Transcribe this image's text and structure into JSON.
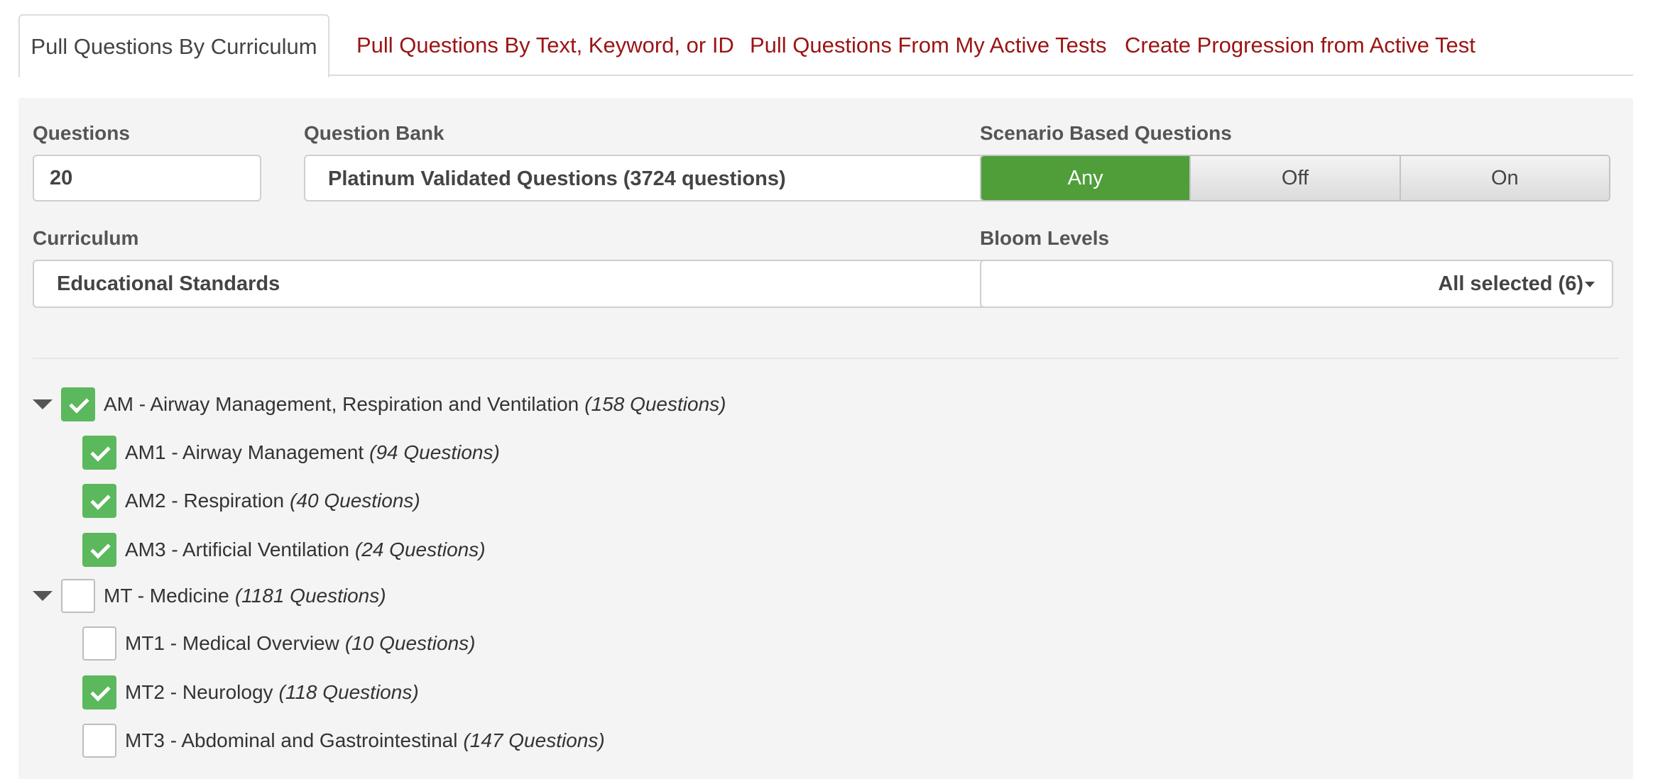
{
  "tabs": [
    {
      "label": "Pull Questions By Curriculum",
      "active": true
    },
    {
      "label": "Pull Questions By Text, Keyword, or ID",
      "active": false
    },
    {
      "label": "Pull Questions From My Active Tests",
      "active": false
    },
    {
      "label": "Create Progression from Active Test",
      "active": false
    }
  ],
  "form": {
    "questions_label": "Questions",
    "questions_value": "20",
    "bank_label": "Question Bank",
    "bank_value": "Platinum Validated Questions (3724 questions)",
    "scenario_label": "Scenario Based Questions",
    "scenario_options": [
      "Any",
      "Off",
      "On"
    ],
    "scenario_selected": "Any",
    "curriculum_label": "Curriculum",
    "curriculum_value": "Educational Standards",
    "bloom_label": "Bloom Levels",
    "bloom_value": "All selected (6)"
  },
  "tree": [
    {
      "code_name": "AM - Airway Management, Respiration and Ventilation",
      "count": "(158 Questions)",
      "checked": true,
      "level": 0
    },
    {
      "code_name": "AM1 - Airway Management",
      "count": "(94 Questions)",
      "checked": true,
      "level": 1
    },
    {
      "code_name": "AM2 - Respiration",
      "count": "(40 Questions)",
      "checked": true,
      "level": 1
    },
    {
      "code_name": "AM3 - Artificial Ventilation",
      "count": "(24 Questions)",
      "checked": true,
      "level": 1
    },
    {
      "code_name": "MT - Medicine",
      "count": "(1181 Questions)",
      "checked": false,
      "level": 0
    },
    {
      "code_name": "MT1 - Medical Overview",
      "count": "(10 Questions)",
      "checked": false,
      "level": 1
    },
    {
      "code_name": "MT2 - Neurology",
      "count": "(118 Questions)",
      "checked": true,
      "level": 1
    },
    {
      "code_name": "MT3 - Abdominal and Gastrointestinal",
      "count": "(147 Questions)",
      "checked": false,
      "level": 1
    }
  ],
  "colors": {
    "accent_green": "#5cb85c",
    "segment_active": "#4f9e3a",
    "tab_link": "#9b1414"
  }
}
